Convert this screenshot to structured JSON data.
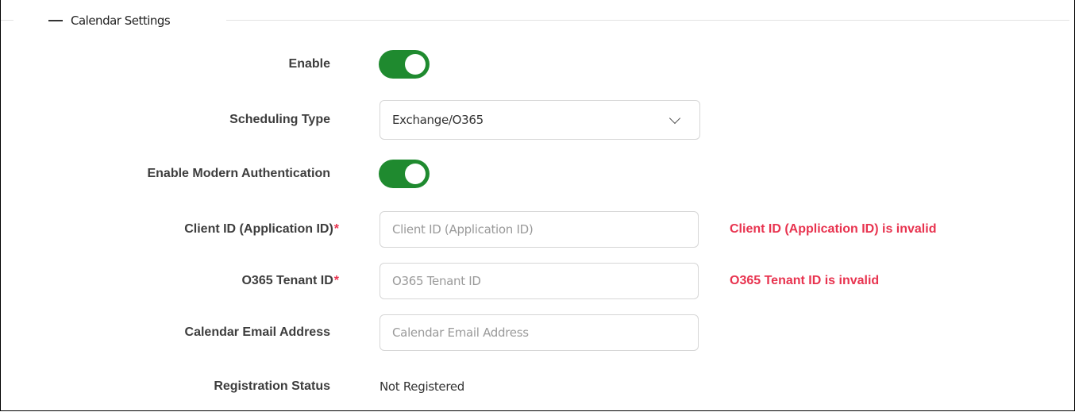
{
  "section": {
    "title": "Calendar Settings"
  },
  "fields": {
    "enable": {
      "label": "Enable",
      "value": "on"
    },
    "scheduling_type": {
      "label": "Scheduling Type",
      "selected": "Exchange/O365"
    },
    "modern_auth": {
      "label": "Enable Modern Authentication",
      "value": "on"
    },
    "client_id": {
      "label": "Client ID (Application ID)",
      "required_mark": "*",
      "placeholder": "Client ID (Application ID)",
      "value": "",
      "error": "Client ID (Application ID) is invalid"
    },
    "tenant_id": {
      "label": "O365 Tenant ID",
      "required_mark": "*",
      "placeholder": "O365 Tenant ID",
      "value": "",
      "error": "O365 Tenant ID is invalid"
    },
    "calendar_email": {
      "label": "Calendar Email Address",
      "placeholder": "Calendar Email Address",
      "value": ""
    },
    "registration_status": {
      "label": "Registration Status",
      "value": "Not Registered"
    }
  },
  "colors": {
    "toggle_on": "#1f8a2f",
    "error": "#e8334f",
    "label": "#3d3d3d",
    "border": "#d6d6d6"
  },
  "icons": {
    "section_toggle": "minus-icon",
    "select_arrow": "chevron-down-icon"
  }
}
